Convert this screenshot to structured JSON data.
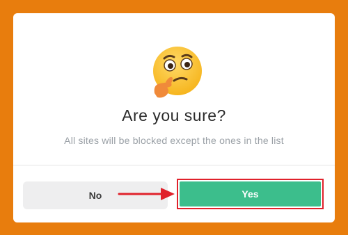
{
  "dialog": {
    "emoji_icon": "thinking-face-emoji",
    "title": "Are you sure?",
    "message": "All sites will be blocked except the ones in the list",
    "no_label": "No",
    "yes_label": "Yes"
  },
  "colors": {
    "background": "#e87d0d",
    "yes_button": "#3cbe8c",
    "no_button": "#eeeeef",
    "highlight": "#e0212b"
  }
}
